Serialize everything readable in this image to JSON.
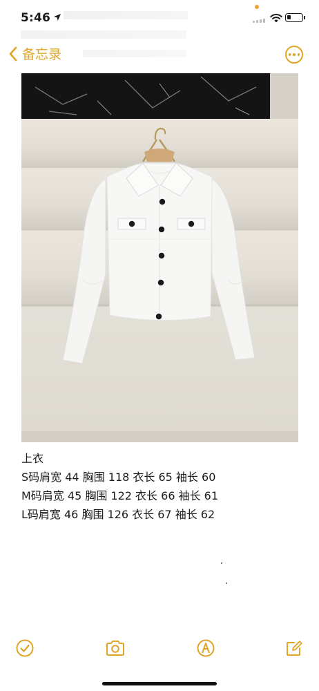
{
  "status_bar": {
    "time": "5:46"
  },
  "nav": {
    "back_label": "备忘录"
  },
  "note": {
    "lines": [
      "上衣",
      " S码肩宽 44 胸围 118 衣长 65 袖长 60",
      "M码肩宽 45 胸围 122 衣长 66 袖长 61",
      "L码肩宽 46 胸围 126 衣长 67 袖长 62"
    ]
  },
  "colors": {
    "accent": "#e0a526",
    "text": "#1b1b1b"
  },
  "toolbar": {
    "icons": [
      "checkmark-circle-icon",
      "camera-icon",
      "markup-pen-icon",
      "compose-icon"
    ]
  }
}
